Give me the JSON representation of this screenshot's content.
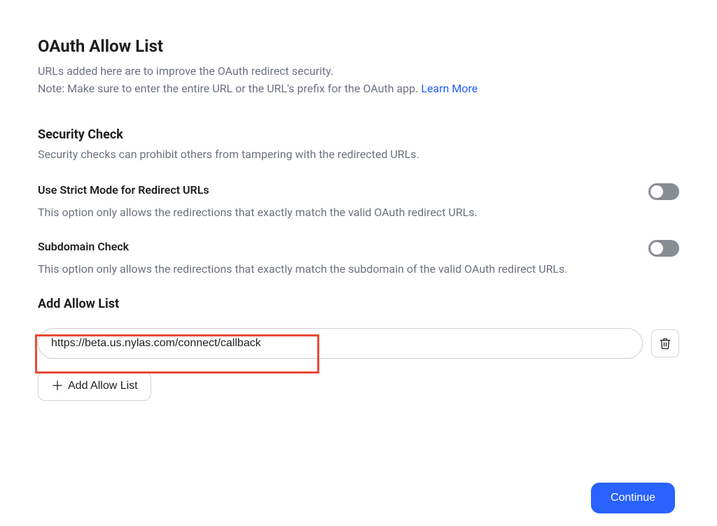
{
  "header": {
    "title": "OAuth Allow List",
    "description_line1": "URLs added here are to improve the OAuth redirect security.",
    "description_line2_prefix": "Note: Make sure to enter the entire URL or the URL's prefix for the OAuth app. ",
    "learn_more": "Learn More"
  },
  "security_check": {
    "title": "Security Check",
    "description": "Security checks can prohibit others from tampering with the redirected URLs."
  },
  "strict_mode": {
    "label": "Use Strict Mode for Redirect URLs",
    "description": "This option only allows the redirections that exactly match the valid OAuth redirect URLs.",
    "enabled": false
  },
  "subdomain_check": {
    "label": "Subdomain Check",
    "description": "This option only allows the redirections that exactly match the subdomain of the valid OAuth redirect URLs.",
    "enabled": false
  },
  "allow_list": {
    "title": "Add Allow List",
    "items": [
      {
        "value": "https://beta.us.nylas.com/connect/callback"
      }
    ],
    "add_button_label": "Add Allow List"
  },
  "footer": {
    "continue_label": "Continue"
  }
}
